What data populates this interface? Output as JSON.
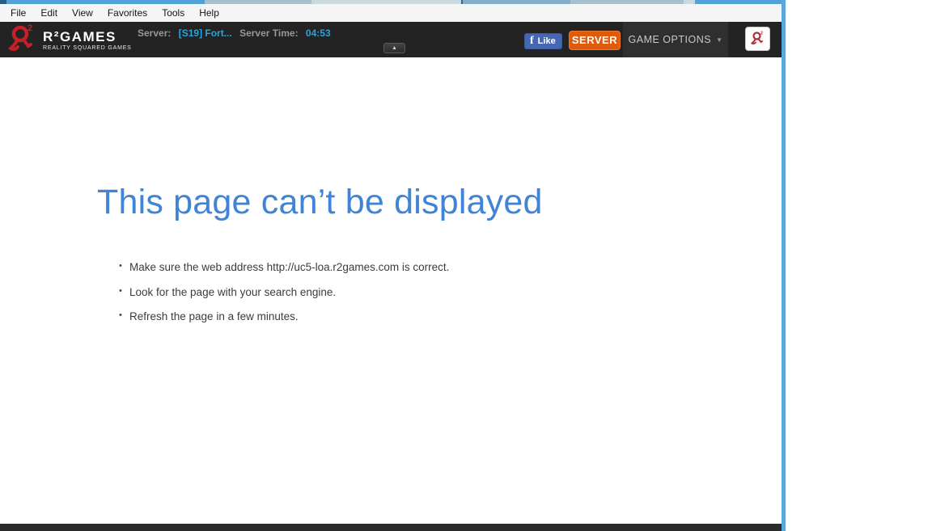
{
  "menu_bar": {
    "items": [
      "File",
      "Edit",
      "View",
      "Favorites",
      "Tools",
      "Help"
    ]
  },
  "header": {
    "brand": "R²GAMES",
    "tagline": "REALITY SQUARED GAMES",
    "server_label": "Server:",
    "server_name": "[S19] Fort...",
    "server_time_label": "Server Time:",
    "server_time": "04:53",
    "like_label": "Like",
    "server_button_label": "SERVER",
    "game_options_label": "GAME OPTIONS"
  },
  "error_page": {
    "title": "This page can’t be displayed",
    "suggestions": [
      "Make sure the web address http://uc5-loa.r2games.com is correct.",
      "Look for the page with your search engine.",
      "Refresh the page in a few minutes."
    ]
  },
  "icons": {
    "facebook_f": "f",
    "collapse_up": "▲",
    "dropdown_down": "▼",
    "bullet": "•"
  },
  "colors": {
    "title_blue": "#4183d4",
    "accent_cyan": "#2aa3dc",
    "facebook_blue": "#4668b3",
    "server_orange": "#e05a0c",
    "logo_red": "#c42027",
    "window_border_blue": "#58a6dd",
    "header_dark": "#232323",
    "footer_dark": "#2b2b2b"
  }
}
